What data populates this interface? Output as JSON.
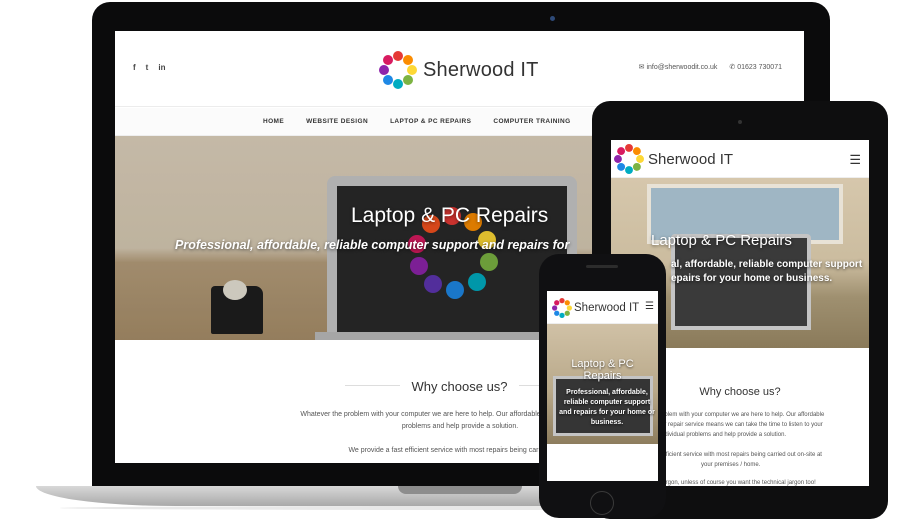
{
  "laptop": {
    "brand": "Sherwood IT",
    "social_icons": [
      "facebook-icon",
      "twitter-icon",
      "linkedin-icon"
    ],
    "social_glyphs": [
      "f",
      "t",
      "in"
    ],
    "email": "info@sherwoodit.co.uk",
    "phone": "01623 730071",
    "nav": [
      "HOME",
      "WEBSITE DESIGN",
      "LAPTOP & PC REPAIRS",
      "COMPUTER TRAINING"
    ],
    "hero_title": "Laptop & PC Repairs",
    "hero_subtitle": "Professional, affordable, reliable computer support and repairs for",
    "why_heading": "Why choose us?",
    "para1": "Whatever the problem with your computer we are here to help. Our affordable mobile computer repair s",
    "para1b": "problems and help provide a solution.",
    "para2": "We provide a fast efficient service with most repairs being carried out on"
  },
  "tablet": {
    "brand": "Sherwood IT",
    "menu_icon": "hamburger-menu-icon",
    "hero_title": "Laptop & PC Repairs",
    "hero_subtitle": "..., affordable, reliable computer support ... epairs for your home or business.",
    "hero_sub_line1": "al, affordable, reliable computer support",
    "hero_sub_line2": "epairs for your home or business.",
    "why_heading": "Why choose us?",
    "para1_line1": "oblem with your computer we are here to help. Our affordable",
    "para1_line2": "er repair service means we can take the time to listen to your",
    "para1_line3": "ndividual problems and help provide a solution.",
    "para2_line1": "efficient service with most repairs being carried out on-site at",
    "para2_line2": "your premises / home.",
    "para3_line1": "jargon, unless of course you want the technical jargon too!"
  },
  "phone": {
    "brand": "Sherwood IT",
    "menu_icon": "hamburger-menu-icon",
    "hero_title_line1": "Laptop & PC",
    "hero_title_line2": "Repairs",
    "hero_sub_line1": "Professional, affordable,",
    "hero_sub_line2": "reliable computer support",
    "hero_sub_line3": "and repairs for your home or",
    "hero_sub_line4": "business."
  },
  "colors": {
    "laptop_bezel": "#0b0b0c",
    "text_dark": "#333333",
    "hero_text": "#ffffff"
  }
}
